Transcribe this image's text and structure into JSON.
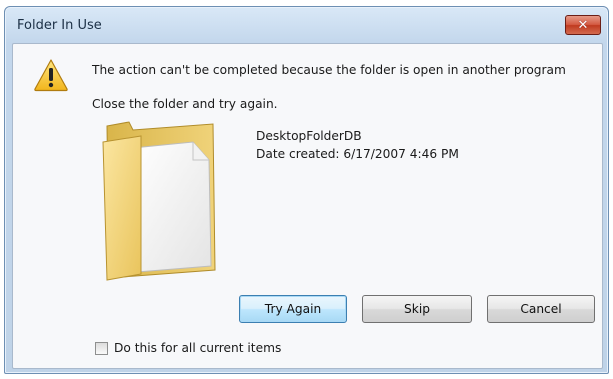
{
  "window": {
    "title": "Folder In Use"
  },
  "message": {
    "heading": "The action can't be completed because the folder is open in another program",
    "subheading": "Close the folder and try again."
  },
  "file": {
    "name": "DesktopFolderDB",
    "date_created": "Date created: 6/17/2007 4:46 PM"
  },
  "buttons": {
    "try_again_label": "Try Again",
    "skip_label": "Skip",
    "cancel_label": "Cancel"
  },
  "checkbox": {
    "label": "Do this for all current items",
    "checked": false
  },
  "icons": {
    "warning": "warning-icon",
    "folder": "folder-icon",
    "close": "close-icon"
  },
  "colors": {
    "close_button": "#c8442a",
    "default_button_border": "#3c7fb1"
  }
}
